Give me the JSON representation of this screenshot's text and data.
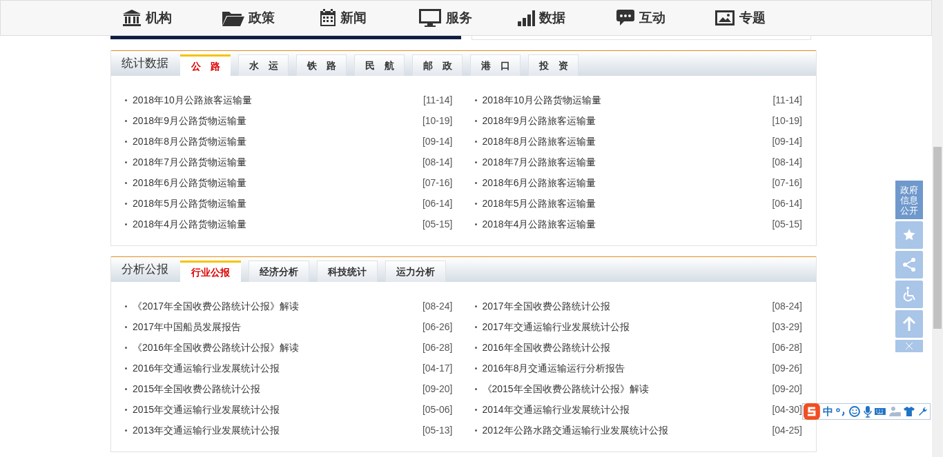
{
  "nav": [
    {
      "label": "机构"
    },
    {
      "label": "政策"
    },
    {
      "label": "新闻"
    },
    {
      "label": "服务"
    },
    {
      "label": "数据"
    },
    {
      "label": "互动"
    },
    {
      "label": "专题"
    }
  ],
  "sections": [
    {
      "title": "统计数据",
      "tabs": [
        {
          "label": "公　路",
          "selected": true
        },
        {
          "label": "水　运",
          "selected": false
        },
        {
          "label": "铁　路",
          "selected": false
        },
        {
          "label": "民　航",
          "selected": false
        },
        {
          "label": "邮　政",
          "selected": false
        },
        {
          "label": "港　口",
          "selected": false
        },
        {
          "label": "投　资",
          "selected": false
        }
      ],
      "left": [
        {
          "title": "2018年10月公路旅客运输量",
          "date": "[11-14]"
        },
        {
          "title": "2018年9月公路货物运输量",
          "date": "[10-19]"
        },
        {
          "title": "2018年8月公路货物运输量",
          "date": "[09-14]"
        },
        {
          "title": "2018年7月公路货物运输量",
          "date": "[08-14]"
        },
        {
          "title": "2018年6月公路货物运输量",
          "date": "[07-16]"
        },
        {
          "title": "2018年5月公路货物运输量",
          "date": "[06-14]"
        },
        {
          "title": "2018年4月公路货物运输量",
          "date": "[05-15]"
        }
      ],
      "right": [
        {
          "title": "2018年10月公路货物运输量",
          "date": "[11-14]"
        },
        {
          "title": "2018年9月公路旅客运输量",
          "date": "[10-19]"
        },
        {
          "title": "2018年8月公路旅客运输量",
          "date": "[09-14]"
        },
        {
          "title": "2018年7月公路旅客运输量",
          "date": "[08-14]"
        },
        {
          "title": "2018年6月公路旅客运输量",
          "date": "[07-16]"
        },
        {
          "title": "2018年5月公路旅客运输量",
          "date": "[06-14]"
        },
        {
          "title": "2018年4月公路旅客运输量",
          "date": "[05-15]"
        }
      ]
    },
    {
      "title": "分析公报",
      "tabs": [
        {
          "label": "行业公报",
          "selected": true
        },
        {
          "label": "经济分析",
          "selected": false
        },
        {
          "label": "科技统计",
          "selected": false
        },
        {
          "label": "运力分析",
          "selected": false
        }
      ],
      "left": [
        {
          "title": "《2017年全国收费公路统计公报》解读",
          "date": "[08-24]"
        },
        {
          "title": "2017年中国船员发展报告",
          "date": "[06-26]"
        },
        {
          "title": "《2016年全国收费公路统计公报》解读",
          "date": "[06-28]"
        },
        {
          "title": "2016年交通运输行业发展统计公报",
          "date": "[04-17]"
        },
        {
          "title": "2015年全国收费公路统计公报",
          "date": "[09-20]"
        },
        {
          "title": "2015年交通运输行业发展统计公报",
          "date": "[05-06]"
        },
        {
          "title": "2013年交通运输行业发展统计公报",
          "date": "[05-13]"
        }
      ],
      "right": [
        {
          "title": "2017年全国收费公路统计公报",
          "date": "[08-24]"
        },
        {
          "title": "2017年交通运输行业发展统计公报",
          "date": "[03-29]"
        },
        {
          "title": "2016年全国收费公路统计公报",
          "date": "[06-28]"
        },
        {
          "title": "2016年8月交通运输运行分析报告",
          "date": "[09-26]"
        },
        {
          "title": "《2015年全国收费公路统计公报》解读",
          "date": "[09-20]"
        },
        {
          "title": "2014年交通运输行业发展统计公报",
          "date": "[04-30]"
        },
        {
          "title": "2012年公路水路交通运输行业发展统计公报",
          "date": "[04-25]"
        }
      ]
    }
  ],
  "side_tools": {
    "label": "政府信息公开"
  },
  "ime": {
    "mode": "中"
  }
}
